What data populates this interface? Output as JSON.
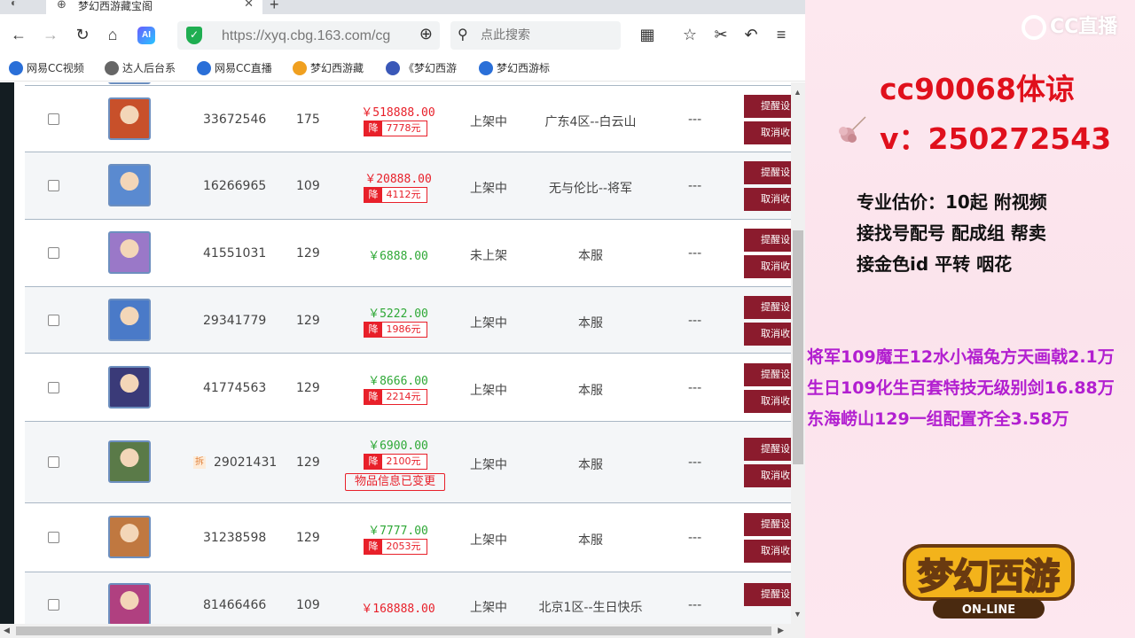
{
  "browser": {
    "tab_title": "梦幻西游藏宝阁",
    "url": "https://xyq.cbg.163.com/cg",
    "search_placeholder": "点此搜索",
    "ai_label": "AI",
    "bookmarks": [
      {
        "label": "网易CC视频",
        "icon": "cc-icon",
        "color": "#2a6fd8"
      },
      {
        "label": "达人后台系",
        "icon": "globe-icon",
        "color": "#666666"
      },
      {
        "label": "网易CC直播",
        "icon": "cc-icon",
        "color": "#2a6fd8"
      },
      {
        "label": "梦幻西游藏",
        "icon": "game-icon",
        "color": "#f0a020"
      },
      {
        "label": "《梦幻西游",
        "icon": "game-icon",
        "color": "#3a58b8"
      },
      {
        "label": "梦幻西游标",
        "icon": "cc-icon",
        "color": "#2a6fd8"
      }
    ]
  },
  "listing": {
    "actions": {
      "remind": "提醒设",
      "cancel": "取消收"
    },
    "rows": [
      {
        "id": "33672546",
        "level": "175",
        "price": "￥518888.00",
        "price_color": "red",
        "discount": "7778元",
        "status": "上架中",
        "server": "广东4区--白云山",
        "extra": "---",
        "avatar_color": "#c8502a"
      },
      {
        "id": "16266965",
        "level": "109",
        "price": "￥20888.00",
        "price_color": "red",
        "discount": "4112元",
        "status": "上架中",
        "server": "无与伦比--将军",
        "extra": "---",
        "avatar_color": "#5a8ad0"
      },
      {
        "id": "41551031",
        "level": "129",
        "price": "￥6888.00",
        "price_color": "green",
        "discount": "",
        "status": "未上架",
        "server": "本服",
        "extra": "---",
        "avatar_color": "#9a78c8"
      },
      {
        "id": "29341779",
        "level": "129",
        "price": "￥5222.00",
        "price_color": "green",
        "discount": "1986元",
        "status": "上架中",
        "server": "本服",
        "extra": "---",
        "avatar_color": "#4a7ac8"
      },
      {
        "id": "41774563",
        "level": "129",
        "price": "￥8666.00",
        "price_color": "green",
        "discount": "2214元",
        "status": "上架中",
        "server": "本服",
        "extra": "---",
        "avatar_color": "#3a3a78"
      },
      {
        "id": "29021431",
        "level": "129",
        "price": "￥6900.00",
        "price_color": "green",
        "discount": "2100元",
        "status": "上架中",
        "server": "本服",
        "extra": "---",
        "avatar_color": "#5a7a48",
        "tag": "拆",
        "note": "物品信息已变更"
      },
      {
        "id": "31238598",
        "level": "129",
        "price": "￥7777.00",
        "price_color": "green",
        "discount": "2053元",
        "status": "上架中",
        "server": "本服",
        "extra": "---",
        "avatar_color": "#c07840"
      },
      {
        "id": "81466466",
        "level": "109",
        "price": "￥168888.00",
        "price_color": "red",
        "discount": "",
        "status": "上架中",
        "server": "北京1区--生日快乐",
        "extra": "---",
        "avatar_color": "#b04080"
      }
    ],
    "discount_label": "降"
  },
  "overlay": {
    "brand": "CC直播",
    "contact_line1": "cc90068体谅",
    "contact_line2": "v：250272543",
    "services": [
      "专业估价：10起  附视频",
      "接找号配号 配成组 帮卖",
      "接金色id 平转 咽花"
    ],
    "promos": [
      "将军109魔王12水小福兔方天画戟2.1万",
      "生日109化生百套特技无级别剑16.88万",
      "东海崂山129一组配置齐全3.58万"
    ],
    "game_logo_text": "梦幻西游",
    "game_logo_sub": "ON-LINE"
  }
}
